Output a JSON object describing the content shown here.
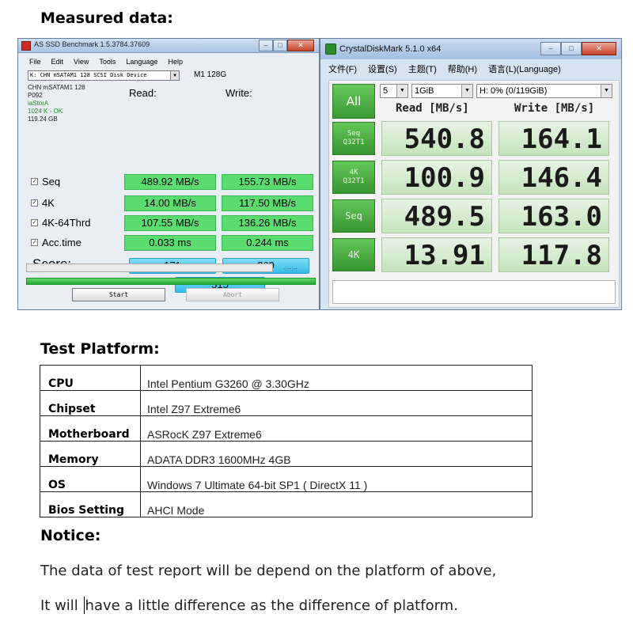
{
  "headings": {
    "measured": "Measured data:",
    "platform": "Test Platform:",
    "notice": "Notice:"
  },
  "asssd": {
    "title": "AS SSD Benchmark 1.5.3784.37609",
    "menu": [
      "File",
      "Edit",
      "View",
      "Tools",
      "Language",
      "Help"
    ],
    "drive_select": "K: CHN mSATAM1 128 SCSI Disk Device",
    "model": "M1 128G",
    "info": [
      "CHN mSATAM1 128",
      "P092",
      "iaStorA",
      "1024 K - OK",
      "119.24 GB"
    ],
    "col_read": "Read:",
    "col_write": "Write:",
    "rows": [
      {
        "label": "Seq",
        "read": "489.92 MB/s",
        "write": "155.73 MB/s"
      },
      {
        "label": "4K",
        "read": "14.00 MB/s",
        "write": "117.50 MB/s"
      },
      {
        "label": "4K-64Thrd",
        "read": "107.55 MB/s",
        "write": "136.26 MB/s"
      },
      {
        "label": "Acc.time",
        "read": "0.033 ms",
        "write": "0.244 ms"
      }
    ],
    "score_label": "Score:",
    "score_read": "171",
    "score_write": "269",
    "score_total": "515",
    "progress_time": "-:--:--",
    "progress_fraction": 1.0,
    "start_label": "Start",
    "abort_label": "Abort"
  },
  "cdm": {
    "title": "CrystalDiskMark 5.1.0 x64",
    "menu": [
      "文件(F)",
      "设置(S)",
      "主题(T)",
      "帮助(H)",
      "语言(L)(Language)"
    ],
    "all_label": "All",
    "count": "5",
    "size": "1GiB",
    "drive": "H: 0% (0/119GiB)",
    "head_read": "Read [MB/s]",
    "head_write": "Write [MB/s]",
    "rows": [
      {
        "line1": "Seq",
        "line2": "Q32T1",
        "read": "540.8",
        "write": "164.1"
      },
      {
        "line1": "4K",
        "line2": "Q32T1",
        "read": "100.9",
        "write": "146.4"
      },
      {
        "line1": "Seq",
        "line2": "",
        "read": "489.5",
        "write": "163.0"
      },
      {
        "line1": "4K",
        "line2": "",
        "read": "13.91",
        "write": "117.8"
      }
    ]
  },
  "platform": [
    {
      "key": "CPU",
      "value": "Intel Pentium G3260 @ 3.30GHz"
    },
    {
      "key": "Chipset",
      "value": "Intel Z97 Extreme6"
    },
    {
      "key": "Motherboard",
      "value": "ASRocK Z97 Extreme6"
    },
    {
      "key": "Memory",
      "value": "ADATA DDR3 1600MHz 4GB"
    },
    {
      "key": "OS",
      "value": "Windows 7 Ultimate 64-bit SP1 ( DirectX 11 )"
    },
    {
      "key": "Bios Setting",
      "value": "AHCI Mode"
    }
  ],
  "notice": {
    "line1": "The data of test report will be depend on the platform of above,",
    "line2_a": "It will ",
    "line2_b": "have a little difference as the difference of platform."
  },
  "colors": {
    "green_cell": "#5bdc6e",
    "score_blue": "#33bce8",
    "cdm_green": "#3a9a34"
  }
}
